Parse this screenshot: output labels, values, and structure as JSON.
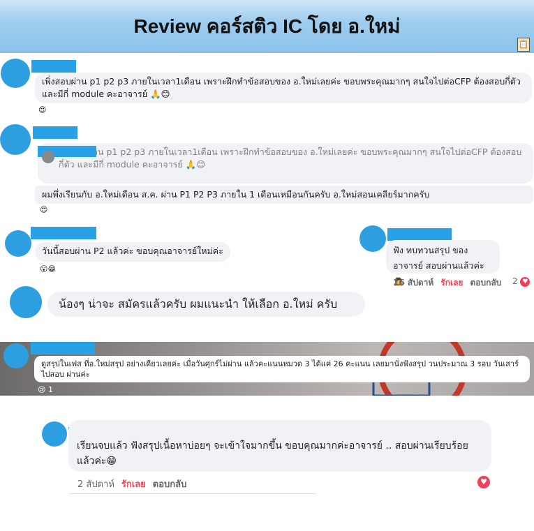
{
  "title": "Review คอร์สติว IC โดย อ.ใหม่",
  "reviews": [
    {
      "text": "เพิ่งสอบผ่าน p1 p2 p3 ภายในเวลา1เดือน เพราะฝึกทำข้อสอบของ อ.ใหม่เลยค่ะ ขอบพระคุณมากๆ สนใจไปต่อCFP ต้องสอบกี่ตัว และมีกี่ module คะอาจารย์ 🙏😊"
    },
    {
      "quote": "เพิ่งสอบผ่าน p1 p2 p3 ภายในเวลา1เดือน เพราะฝึกทำข้อสอบของ อ.ใหม่เลยค่ะ ขอบพระคุณมากๆ สนใจไปต่อCFP ต้องสอบกี่ตัว และมีกี่ module คะอาจารย์ 🙏😊",
      "text": "ผมพึ่งเรียนกับ อ.ใหม่เดือน ส.ค. ผ่าน P1 P2 P3 ภายใน 1 เดือนเหมือนกันครับ อ.ใหม่สอนเคลียร์มากครับ"
    },
    {
      "text": "วันนี้สอบผ่าน P2 แล้วค่ะ ขอบคุณอาจารย์ใหม่ค่ะ"
    },
    {
      "text": "ฟัง ทบทวนสรุป ของอาจารย์ สอบผ่านแล้วค่ะ🙇",
      "time": "16 สัปดาห์",
      "love": "รักเลย",
      "reply": "ตอบกลับ",
      "count": "2"
    },
    {
      "text": "น้องๆ น่าจะ สมัครแล้วครับ ผมแนะนำ  ให้เลือก อ.ใหม่ ครับ"
    },
    {
      "text": "ดูสรุปในเฟส ที่อ.ใหม่สรุป อย่างเดียวเลยค่ะ เมื่อวันศุกร์ไม่ผ่าน แล้วคะแนนหมวด 3 ได้แค่ 26 คะแนน เลยมานั่งฟังสรุป วนประมาณ 3 รอบ วันเสาร์ไปสอบ ผ่านค่ะ",
      "reaction_count": "1"
    },
    {
      "text": "เรียนจบแล้ว ฟังสรุปเนื้อหาบ่อยๆ จะเข้าใจมากขึ้น ขอบคุณมากค่ะอาจารย์ .. สอบผ่านเรียบร้อยแล้วค่ะ😁",
      "time": "2 สัปดาห์",
      "love": "รักเลย",
      "reply": "ตอบกลับ"
    }
  ],
  "colors": {
    "accent": "#28a1e6",
    "love": "#f33e58",
    "bubble": "#f0f2f5"
  }
}
